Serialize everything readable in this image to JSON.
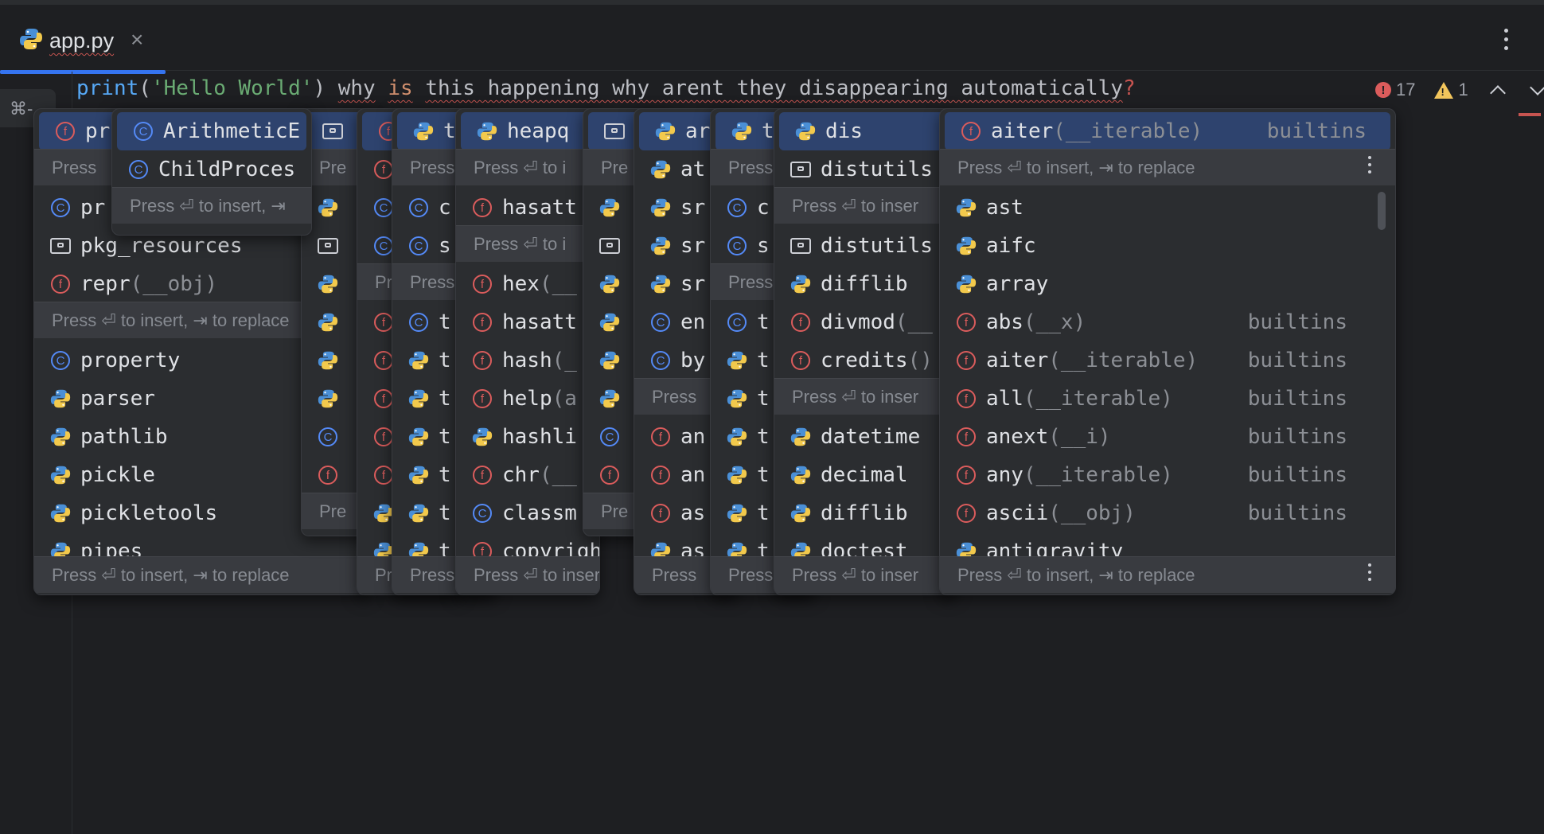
{
  "tab": {
    "filename": "app.py",
    "close": "×"
  },
  "gutter": {
    "shortcut": "⌘-"
  },
  "code": {
    "fn": "print",
    "open": "(",
    "str": "'Hello World'",
    "close": ")",
    "space": " ",
    "t1": "why",
    "kw": "is",
    "t2": "this happening why arent they disappearing automatically",
    "q": "?"
  },
  "inspections": {
    "errors": "17",
    "warnings": "1"
  },
  "colors": {
    "accent": "#3574f0",
    "selection": "#2e436e",
    "function_icon": "#db5c5c",
    "class_icon": "#548af7",
    "string": "#6aab73",
    "keyword": "#cf8e6d"
  },
  "hint_text": "Press ⏎ to insert, ⇥ to replace",
  "popups": [
    {
      "id": "p1",
      "rows": [
        {
          "icon": "function-icon",
          "name": "pr",
          "sig": "",
          "src": "",
          "selected": true
        },
        {
          "hint": "Press"
        },
        {
          "icon": "class-icon",
          "name": "pr",
          "sig": "",
          "src": ""
        },
        {
          "icon": "package-icon",
          "name": "pkg_resources",
          "sig": "",
          "src": ""
        },
        {
          "icon": "function-icon",
          "name": "repr",
          "sig": "(__obj)",
          "src": ""
        },
        {
          "hint": "Press ⏎ to insert, ⇥ to replace"
        },
        {
          "icon": "class-icon",
          "name": "property",
          "sig": "",
          "src": ""
        },
        {
          "icon": "python-module-icon",
          "name": "parser",
          "sig": "",
          "src": ""
        },
        {
          "icon": "python-module-icon",
          "name": "pathlib",
          "sig": "",
          "src": ""
        },
        {
          "icon": "python-module-icon",
          "name": "pickle",
          "sig": "",
          "src": ""
        },
        {
          "icon": "python-module-icon",
          "name": "pickletools",
          "sig": "",
          "src": ""
        },
        {
          "icon": "python-module-icon",
          "name": "pipes",
          "sig": "",
          "src": ""
        }
      ],
      "footer": "Press ⏎ to insert, ⇥ to replace"
    },
    {
      "id": "p2",
      "rows": [
        {
          "icon": "class-icon",
          "name": "ArithmeticE",
          "sig": "",
          "src": "",
          "selected": true
        },
        {
          "icon": "class-icon",
          "name": "ChildProces",
          "sig": "",
          "src": ""
        },
        {
          "hint": "Press ⏎ to insert, ⇥"
        }
      ]
    },
    {
      "id": "p3",
      "rows": [
        {
          "icon": "package-icon",
          "name": "",
          "selected": true
        },
        {
          "hint": "Pre"
        },
        {
          "icon": "python-module-icon",
          "name": ""
        },
        {
          "icon": "package-icon",
          "name": ""
        },
        {
          "icon": "python-module-icon",
          "name": ""
        },
        {
          "icon": "python-module-icon",
          "name": ""
        },
        {
          "icon": "python-module-icon",
          "name": ""
        },
        {
          "icon": "python-module-icon",
          "name": ""
        },
        {
          "icon": "class-icon",
          "name": ""
        },
        {
          "icon": "function-icon",
          "name": ""
        },
        {
          "hint": "Pre"
        }
      ]
    },
    {
      "id": "p4",
      "rows": [
        {
          "icon": "function-icon",
          "name": "",
          "selected": true
        },
        {
          "icon": "function-icon",
          "name": ""
        },
        {
          "icon": "class-icon",
          "name": ""
        },
        {
          "icon": "class-icon",
          "name": ""
        },
        {
          "hint": "Pr"
        },
        {
          "icon": "function-icon",
          "name": ""
        },
        {
          "icon": "function-icon",
          "name": ""
        },
        {
          "icon": "function-icon",
          "name": ""
        },
        {
          "icon": "function-icon",
          "name": ""
        },
        {
          "icon": "function-icon",
          "name": ""
        },
        {
          "icon": "python-module-icon",
          "name": ""
        },
        {
          "icon": "python-module-icon",
          "name": ""
        }
      ],
      "footer": "Pr"
    },
    {
      "id": "p5",
      "rows": [
        {
          "icon": "python-module-icon",
          "name": "t",
          "selected": true
        },
        {
          "hint": "Press"
        },
        {
          "icon": "class-icon",
          "name": "c"
        },
        {
          "icon": "class-icon",
          "name": "s"
        },
        {
          "hint": "Press"
        },
        {
          "icon": "class-icon",
          "name": "t"
        },
        {
          "icon": "python-module-icon",
          "name": "t"
        },
        {
          "icon": "python-module-icon",
          "name": "t"
        },
        {
          "icon": "python-module-icon",
          "name": "t"
        },
        {
          "icon": "python-module-icon",
          "name": "t"
        },
        {
          "icon": "python-module-icon",
          "name": "t"
        },
        {
          "icon": "python-module-icon",
          "name": "t"
        }
      ],
      "footer": "Press"
    },
    {
      "id": "p6",
      "rows": [
        {
          "icon": "python-module-icon",
          "name": "heapq",
          "selected": true
        },
        {
          "hint": "Press ⏎ to i"
        },
        {
          "icon": "function-icon",
          "name": "hasatt"
        },
        {
          "hint": "Press ⏎ to i"
        },
        {
          "icon": "function-icon",
          "name": "hex",
          "sig": "(__"
        },
        {
          "icon": "function-icon",
          "name": "hasatt"
        },
        {
          "icon": "function-icon",
          "name": "hash",
          "sig": "(_"
        },
        {
          "icon": "function-icon",
          "name": "help",
          "sig": "(a"
        },
        {
          "icon": "python-module-icon",
          "name": "hashli"
        },
        {
          "icon": "function-icon",
          "name": "chr",
          "sig": "(__"
        },
        {
          "icon": "class-icon",
          "name": "classm"
        },
        {
          "icon": "function-icon",
          "name": "copyright",
          "sig": "("
        }
      ],
      "footer": "Press ⏎ to insert,"
    },
    {
      "id": "p7",
      "rows": [
        {
          "icon": "package-icon",
          "name": "",
          "selected": true
        },
        {
          "hint": "Pre"
        },
        {
          "icon": "python-module-icon",
          "name": ""
        },
        {
          "icon": "package-icon",
          "name": ""
        },
        {
          "icon": "python-module-icon",
          "name": ""
        },
        {
          "icon": "python-module-icon",
          "name": ""
        },
        {
          "icon": "python-module-icon",
          "name": ""
        },
        {
          "icon": "python-module-icon",
          "name": ""
        },
        {
          "icon": "class-icon",
          "name": ""
        },
        {
          "icon": "function-icon",
          "name": ""
        },
        {
          "hint": "Pre"
        }
      ]
    },
    {
      "id": "p8",
      "rows": [
        {
          "icon": "python-module-icon",
          "name": "ar",
          "selected": true
        },
        {
          "icon": "python-module-icon",
          "name": "at"
        },
        {
          "icon": "python-module-icon",
          "name": "sr"
        },
        {
          "icon": "python-module-icon",
          "name": "sr"
        },
        {
          "icon": "python-module-icon",
          "name": "sr"
        },
        {
          "icon": "class-icon",
          "name": "en"
        },
        {
          "icon": "class-icon",
          "name": "by"
        },
        {
          "hint": "Press"
        },
        {
          "icon": "function-icon",
          "name": "an"
        },
        {
          "icon": "function-icon",
          "name": "an"
        },
        {
          "icon": "function-icon",
          "name": "as"
        },
        {
          "icon": "python-module-icon",
          "name": "as"
        }
      ],
      "footer": "Press"
    },
    {
      "id": "p9",
      "rows": [
        {
          "icon": "python-module-icon",
          "name": "t",
          "selected": true
        },
        {
          "hint": "Press"
        },
        {
          "icon": "class-icon",
          "name": "c"
        },
        {
          "icon": "class-icon",
          "name": "s"
        },
        {
          "hint": "Press"
        },
        {
          "icon": "class-icon",
          "name": "t"
        },
        {
          "icon": "python-module-icon",
          "name": "t"
        },
        {
          "icon": "python-module-icon",
          "name": "t"
        },
        {
          "icon": "python-module-icon",
          "name": "t"
        },
        {
          "icon": "python-module-icon",
          "name": "t"
        },
        {
          "icon": "python-module-icon",
          "name": "t"
        },
        {
          "icon": "python-module-icon",
          "name": "t"
        }
      ],
      "footer": "Press"
    },
    {
      "id": "p10",
      "rows": [
        {
          "icon": "python-module-icon",
          "name": "dis",
          "selected": true
        },
        {
          "icon": "package-icon",
          "name": "distutils"
        },
        {
          "hint": "Press ⏎ to inser"
        },
        {
          "icon": "package-icon",
          "name": "distutils"
        },
        {
          "icon": "python-module-icon",
          "name": "difflib"
        },
        {
          "icon": "function-icon",
          "name": "divmod",
          "sig": "(__"
        },
        {
          "icon": "function-icon",
          "name": "credits",
          "sig": "()"
        },
        {
          "hint": "Press ⏎ to inser"
        },
        {
          "icon": "python-module-icon",
          "name": "datetime"
        },
        {
          "icon": "python-module-icon",
          "name": "decimal"
        },
        {
          "icon": "python-module-icon",
          "name": "difflib"
        },
        {
          "icon": "python-module-icon",
          "name": "doctest"
        }
      ],
      "footer": "Press ⏎ to inser"
    },
    {
      "id": "p11",
      "rows": [
        {
          "icon": "function-icon",
          "name": "aiter",
          "sig": "(__iterable)",
          "src": "builtins",
          "selected": true
        },
        {
          "hint": "Press ⏎ to insert, ⇥ to replace",
          "menu": true
        },
        {
          "icon": "python-module-icon",
          "name": "ast",
          "sig": "",
          "src": ""
        },
        {
          "icon": "python-module-icon",
          "name": "aifc",
          "sig": "",
          "src": ""
        },
        {
          "icon": "python-module-icon",
          "name": "array",
          "sig": "",
          "src": ""
        },
        {
          "icon": "function-icon",
          "name": "abs",
          "sig": "(__x)",
          "src": "builtins"
        },
        {
          "icon": "function-icon",
          "name": "aiter",
          "sig": "(__iterable)",
          "src": "builtins"
        },
        {
          "icon": "function-icon",
          "name": "all",
          "sig": "(__iterable)",
          "src": "builtins"
        },
        {
          "icon": "function-icon",
          "name": "anext",
          "sig": "(__i)",
          "src": "builtins"
        },
        {
          "icon": "function-icon",
          "name": "any",
          "sig": "(__iterable)",
          "src": "builtins"
        },
        {
          "icon": "function-icon",
          "name": "ascii",
          "sig": "(__obj)",
          "src": "builtins"
        },
        {
          "icon": "python-module-icon",
          "name": "antigravity",
          "sig": "",
          "src": ""
        }
      ],
      "footer": "Press ⏎ to insert, ⇥ to replace",
      "footer_menu": true
    }
  ]
}
